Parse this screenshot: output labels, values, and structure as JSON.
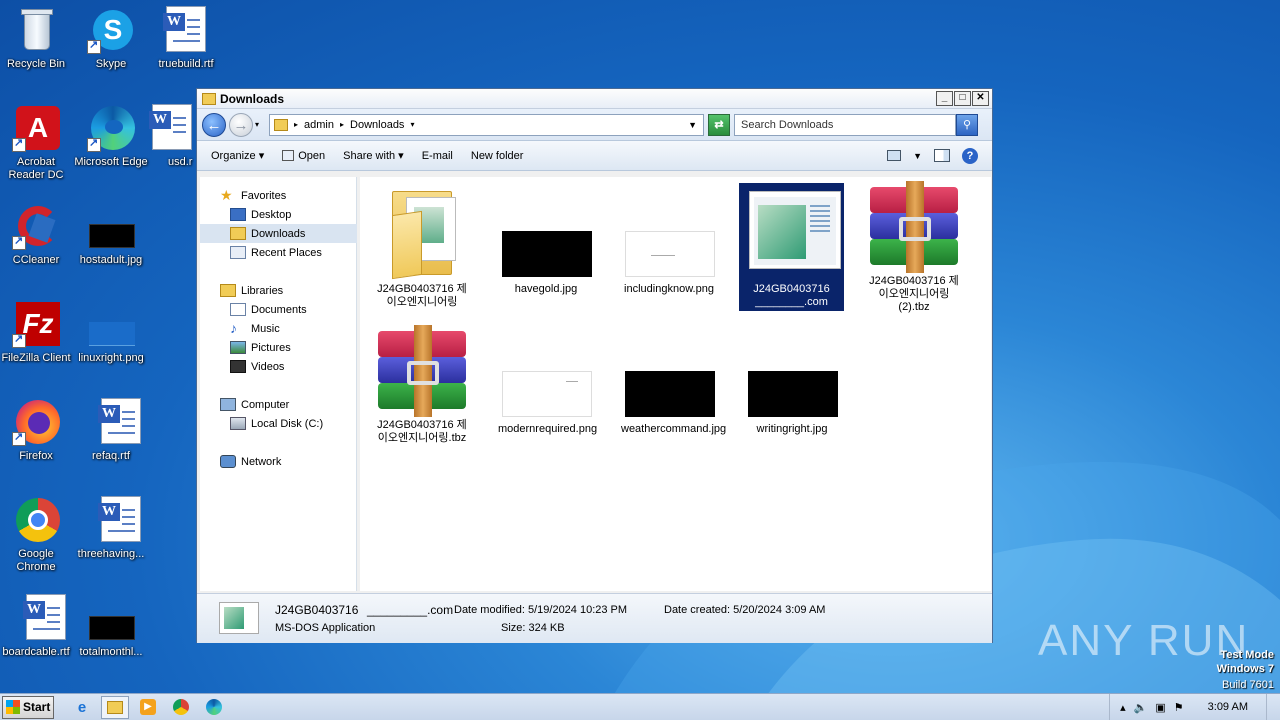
{
  "desktop": {
    "icons": [
      {
        "label": "Recycle Bin",
        "icon": "recycle-bin-icon"
      },
      {
        "label": "Skype",
        "icon": "skype-icon"
      },
      {
        "label": "truebuild.rtf",
        "icon": "word-doc-icon"
      },
      {
        "label": "Acrobat Reader DC",
        "icon": "acrobat-icon"
      },
      {
        "label": "Microsoft Edge",
        "icon": "edge-icon"
      },
      {
        "label": "usd.r",
        "icon": "word-doc-icon"
      },
      {
        "label": "CCleaner",
        "icon": "ccleaner-icon"
      },
      {
        "label": "hostadult.jpg",
        "icon": "image-thumb-icon"
      },
      {
        "label": "FileZilla Client",
        "icon": "filezilla-icon"
      },
      {
        "label": "linuxright.png",
        "icon": "image-thumb-icon"
      },
      {
        "label": "Firefox",
        "icon": "firefox-icon"
      },
      {
        "label": "refaq.rtf",
        "icon": "word-doc-icon"
      },
      {
        "label": "Google Chrome",
        "icon": "chrome-icon"
      },
      {
        "label": "threehaving...",
        "icon": "word-doc-icon"
      },
      {
        "label": "boardcable.rtf",
        "icon": "word-doc-icon"
      },
      {
        "label": "totalmonthl...",
        "icon": "image-thumb-icon"
      }
    ]
  },
  "window": {
    "title": "Downloads",
    "buttons": {
      "minimize": "_",
      "maximize": "□",
      "close": "✕"
    },
    "breadcrumb": [
      "admin",
      "Downloads"
    ],
    "search_placeholder": "Search Downloads",
    "commands": [
      "Organize ▾",
      "Open",
      "Share with ▾",
      "E-mail",
      "New folder"
    ],
    "nav": {
      "favorites": "Favorites",
      "desktop": "Desktop",
      "downloads": "Downloads",
      "recent": "Recent Places",
      "libraries": "Libraries",
      "documents": "Documents",
      "music": "Music",
      "pictures": "Pictures",
      "videos": "Videos",
      "computer": "Computer",
      "localdisk": "Local Disk (C:)",
      "network": "Network"
    },
    "files": [
      {
        "name": "J24GB0403716  제이오엔지니어링",
        "kind": "folder"
      },
      {
        "name": "havegold.jpg",
        "kind": "dark-image"
      },
      {
        "name": "includingknow.png",
        "kind": "light-image"
      },
      {
        "name": "J24GB0403716 ________.com",
        "kind": "exe",
        "selected": true
      },
      {
        "name": "J24GB0403716  제이오엔지니어링(2).tbz",
        "kind": "rar"
      },
      {
        "name": "J24GB0403716  제이오엔지니어링.tbz",
        "kind": "rar"
      },
      {
        "name": "modernrequired.png",
        "kind": "light-image"
      },
      {
        "name": "weathercommand.jpg",
        "kind": "dark-image"
      },
      {
        "name": "writingright.jpg",
        "kind": "dark-image"
      }
    ],
    "status": {
      "name": "J24GB0403716",
      "blank": "_________.com",
      "type": "MS-DOS Application",
      "modified": "Date modified: 5/19/2024 10:23 PM",
      "size": "Size: 324 KB",
      "created": "Date created: 5/20/2024 3:09 AM"
    }
  },
  "taskbar": {
    "start_label": "Start",
    "clock": "3:09 AM"
  },
  "watermark": {
    "brand": "ANY RUN",
    "line1": "Test Mode",
    "line2": "Windows 7",
    "line3": "Build 7601"
  }
}
